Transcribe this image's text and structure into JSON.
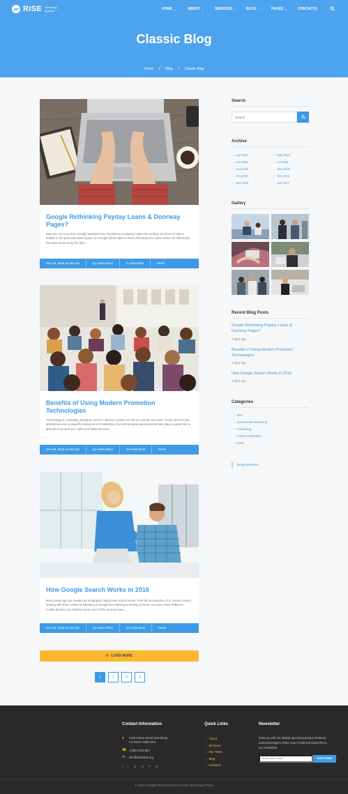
{
  "brand": {
    "name": "RISE",
    "tagline": "Marketing Agency"
  },
  "nav": {
    "items": [
      {
        "label": "HOME",
        "has_dropdown": true
      },
      {
        "label": "ABOUT",
        "has_dropdown": true
      },
      {
        "label": "SERVICES",
        "has_dropdown": true
      },
      {
        "label": "BLOG",
        "has_dropdown": true
      },
      {
        "label": "PAGES",
        "has_dropdown": true
      },
      {
        "label": "CONTACTS",
        "has_dropdown": false
      }
    ],
    "search_icon": "search-icon"
  },
  "hero": {
    "title": "Classic Blog",
    "breadcrumbs": [
      "Home",
      "Blog",
      "Classic Blog"
    ],
    "separator": "/"
  },
  "posts": [
    {
      "title": "Google Rethinking Payday Loans & Doorway Pages?",
      "excerpt": "Best yet, not only does Google maintain their investment in payday loans via LendUp, but there is also a bubble in the personal loans space, so Google will be able to show effectively the same advice for effectively the same terms & by the time...",
      "date": "Dec 28, 2016 at 5:57 pm",
      "author": "by Austin Riley",
      "comments": "2 Comments",
      "category": "News"
    },
    {
      "title": "Benefits of Using Modern Promotion Technologies",
      "excerpt": "Technology is constantly changing, and it is obvious it takes our life to a whole new level. As the Internet has already become a powerful instrument of marketing, the technological advancement also plays a great role in promotion as well as in SEO and SMM services.",
      "date": "Dec 28, 2016 at 5:57 pm",
      "author": "by Austin Riley",
      "comments": "12 Comments",
      "category": "News"
    },
    {
      "title": "How Google Search Works in 2016",
      "excerpt": "Many years ago we created an infographic about how search works, from the perspective of a content creator, starting with their content & following it through the indexing & ranking process. As users have shifted to mobile devices, the limited screen size of the devices have...",
      "date": "Dec 28, 2016 at 5:57 pm",
      "author": "by Austin Riley",
      "comments": "12 Comments",
      "category": "News"
    }
  ],
  "load_more": "LOAD MORE",
  "pagination": [
    "1",
    "2",
    "3",
    "4"
  ],
  "sidebar": {
    "search": {
      "heading": "Search",
      "placeholder": "Search"
    },
    "archive": {
      "heading": "Archive",
      "left": [
        "Apr 2016",
        "Jun 2016",
        "Aug 2016",
        "Oct 2016",
        "Dec 2016"
      ],
      "right": [
        "May 2016",
        "Jul 2016",
        "Sep 2016",
        "Nov 2016",
        "Jan 2017"
      ]
    },
    "gallery": {
      "heading": "Gallery"
    },
    "recent": {
      "heading": "Recent Blog Posts",
      "items": [
        {
          "title": "Google Rethinking Payday Loans & Doorway Pages?",
          "date": "2 days ago"
        },
        {
          "title": "Benefits of Using Modern Promotion Technologies",
          "date": "2 days ago"
        },
        {
          "title": "How Google Search Works in 2016",
          "date": "2 days ago"
        }
      ]
    },
    "categories": {
      "heading": "Categories",
      "items": [
        "SEO",
        "Social Media Marketing",
        "Advertising",
        "Content Marketing",
        "News"
      ]
    },
    "template_link": "TemplateMonster"
  },
  "footer": {
    "contact": {
      "heading": "Contact Information",
      "address_line1": "2130 Fulton Street San Diego,",
      "address_line2": "CA 94117-1080 USA",
      "phone": "1-800-1234-567",
      "email": "info@demolink.org"
    },
    "quick_links": {
      "heading": "Quick Links",
      "items": [
        "About",
        "Services",
        "Our Team",
        "Blog",
        "Contacts"
      ]
    },
    "newsletter": {
      "heading": "Newsletter",
      "text_line1": "Keep up with our always upcoming product features",
      "text_line2": "and technologies. Enter your e-mail and subscribe to",
      "text_line3": "our newsletter.",
      "placeholder": "Enter your e-mail",
      "button": "SUBSCRIBE"
    },
    "socials": [
      "f",
      "t",
      "◎",
      "G",
      "P",
      "in"
    ],
    "copyright": "© 2017 All Rights Reserved Terms of Use and Privacy Policy"
  },
  "colors": {
    "primary": "#4da3ed",
    "link": "#3d9ae8",
    "accent": "#fbb82f",
    "footer": "#2a2a2c"
  }
}
